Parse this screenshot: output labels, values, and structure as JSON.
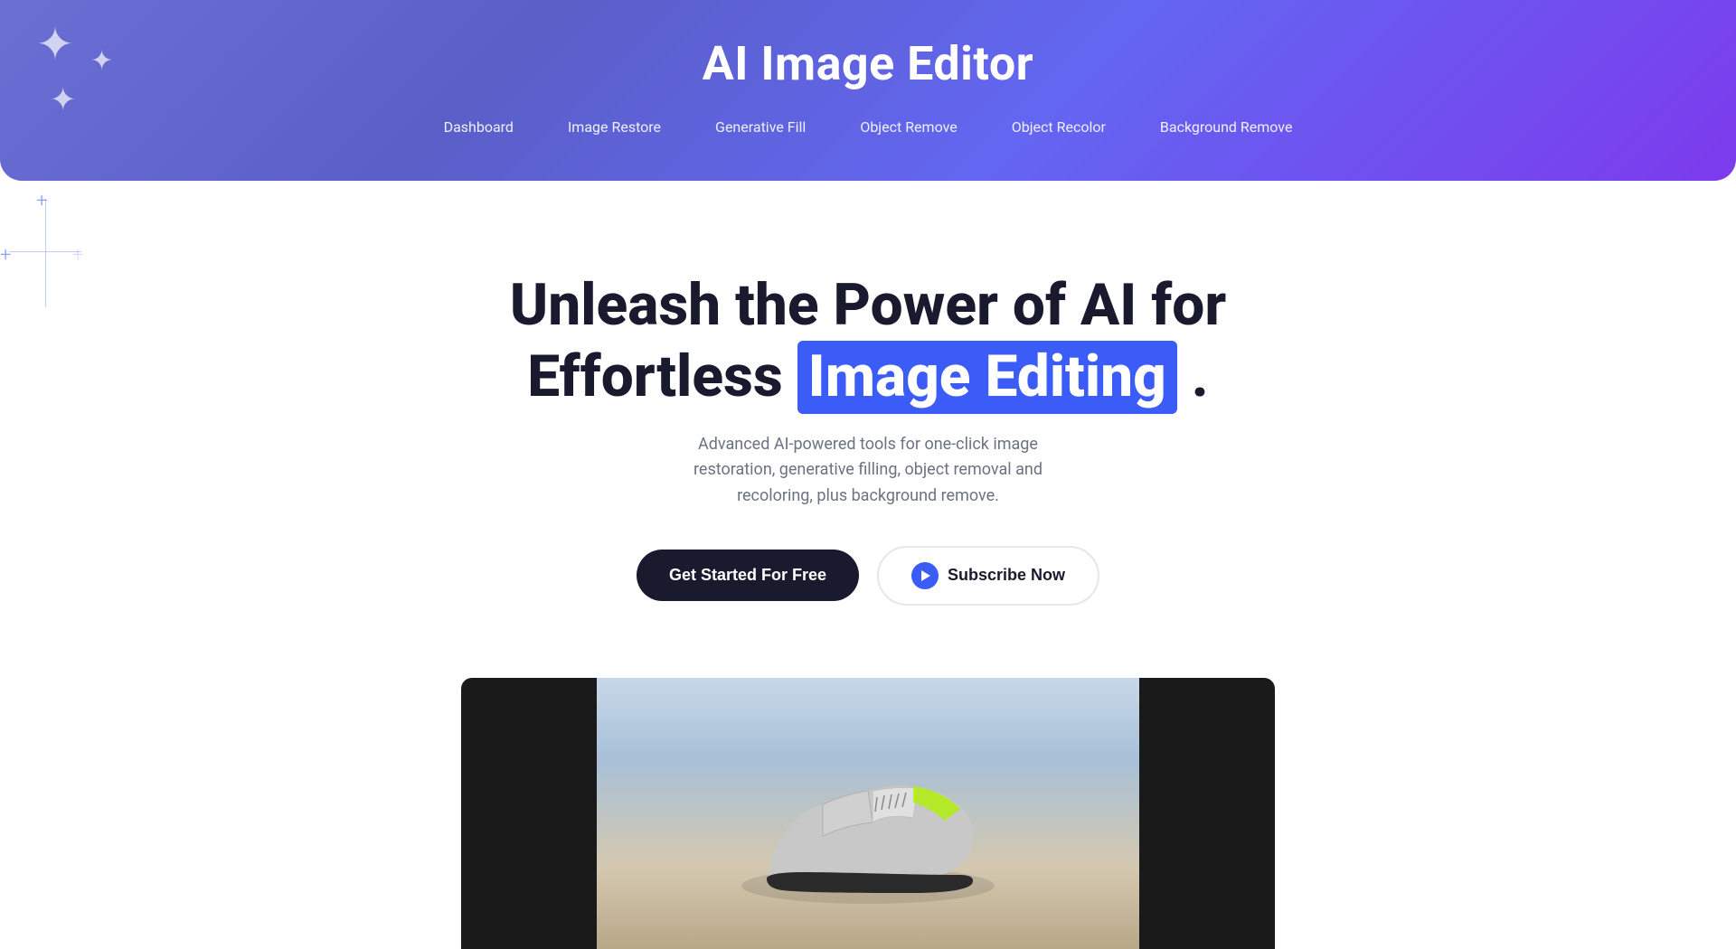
{
  "header": {
    "title": "AI Image Editor",
    "gradient_start": "#6b6fd4",
    "gradient_end": "#7c3aed"
  },
  "nav": {
    "items": [
      {
        "id": "dashboard",
        "label": "Dashboard"
      },
      {
        "id": "image-restore",
        "label": "Image Restore"
      },
      {
        "id": "generative-fill",
        "label": "Generative Fill"
      },
      {
        "id": "object-remove",
        "label": "Object Remove"
      },
      {
        "id": "object-recolor",
        "label": "Object Recolor"
      },
      {
        "id": "background-remove",
        "label": "Background Remove"
      }
    ]
  },
  "hero": {
    "heading_line1": "Unleash the Power of AI for",
    "heading_line2_before": "Effortless",
    "heading_highlight": "Image Editing",
    "heading_line2_after": ".",
    "subtext": "Advanced AI-powered tools for one-click image restoration, generative filling, object removal and recoloring, plus background remove.",
    "btn_primary": "Get Started For Free",
    "btn_secondary": "Subscribe Now"
  },
  "colors": {
    "accent_blue": "#3b5cf6",
    "dark": "#1a1a2e",
    "gray_text": "#6b7280",
    "white": "#ffffff"
  },
  "decorative": {
    "sparkle_char": "✦",
    "cross_char": "+"
  }
}
